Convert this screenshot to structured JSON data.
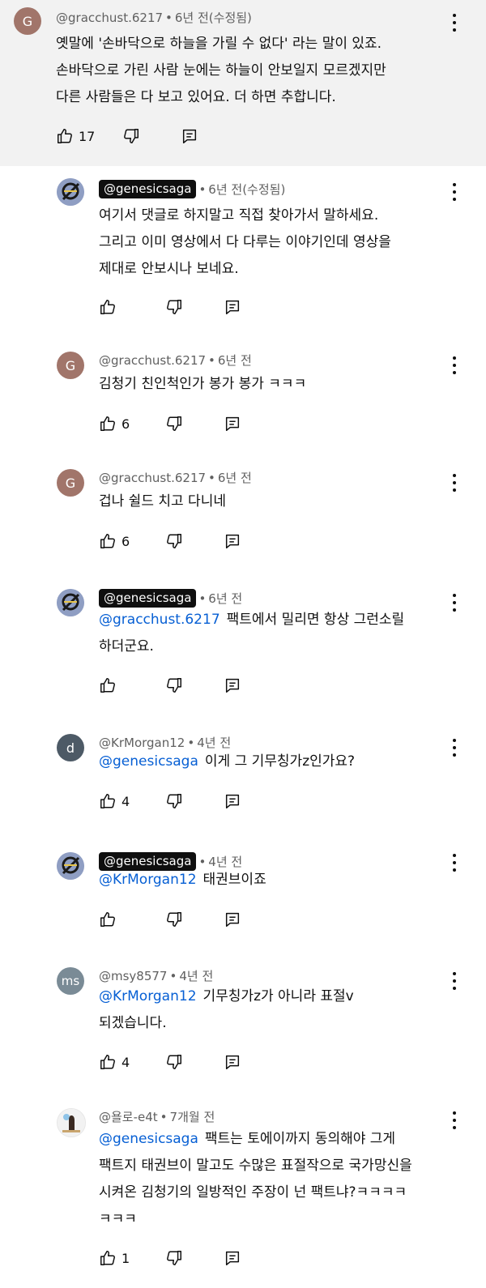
{
  "comments": [
    {
      "avatar_letter": "G",
      "author": "@gracchust.6217",
      "time": "6년 전(수정됨)",
      "lines": [
        "옛말에 '손바닥으로 하늘을 가릴 수 없다' 라는 말이 있죠.",
        "손바닥으로 가린 사람 눈에는 하늘이 안보일지 모르겠지만",
        "다른 사람들은 다 보고 있어요. 더 하면 추합니다."
      ],
      "likes": "17"
    },
    {
      "author": "@genesicsaga",
      "time": "6년 전(수정됨)",
      "lines": [
        "여기서 댓글로 하지말고 직접 찾아가서 말하세요.",
        "그리고 이미 영상에서 다 다루는 이야기인데 영상을",
        "제대로 안보시나 보네요."
      ],
      "likes": ""
    },
    {
      "avatar_letter": "G",
      "author": "@gracchust.6217",
      "time": "6년 전",
      "lines": [
        "김청기 친인척인가 봉가 봉가 ㅋㅋㅋ"
      ],
      "likes": "6"
    },
    {
      "avatar_letter": "G",
      "author": "@gracchust.6217",
      "time": "6년 전",
      "lines": [
        "겁나 쉴드 치고 다니네"
      ],
      "likes": "6"
    },
    {
      "author": "@genesicsaga",
      "time": "6년 전",
      "mention": "@gracchust.6217",
      "line1_rest": "팩트에서 밀리면 항상 그런소릴",
      "lines_after": [
        "하더군요."
      ],
      "likes": ""
    },
    {
      "avatar_letter": "d",
      "author": "@KrMorgan12",
      "time": "4년 전",
      "mention": "@genesicsaga",
      "line1_rest": "이게 그 기무칭가z인가요?",
      "likes": "4"
    },
    {
      "author": "@genesicsaga",
      "time": "4년 전",
      "mention": "@KrMorgan12",
      "line1_rest": "태권브이죠",
      "likes": ""
    },
    {
      "avatar_letter": "ms",
      "author": "@msy8577",
      "time": "4년 전",
      "mention": "@KrMorgan12",
      "line1_rest": "기무칭가z가 아니라 표절v",
      "lines_after": [
        "되겠습니다."
      ],
      "likes": "4"
    },
    {
      "author": "@욜로-e4t",
      "time": "7개월 전",
      "mention": "@genesicsaga",
      "line1_rest": "팩트는 토에이까지 동의해야 그게",
      "lines_after": [
        "팩트지 태권브이 말고도 수많은 표절작으로 국가망신을",
        "시켜온 김청기의 일방적인 주장이 넌 팩트냐?ㅋㅋㅋㅋ",
        "ㅋㅋㅋ"
      ],
      "likes": "1"
    }
  ],
  "separator": "•",
  "icons": [
    "like-icon",
    "dislike-icon",
    "reply-icon",
    "more-icon"
  ]
}
